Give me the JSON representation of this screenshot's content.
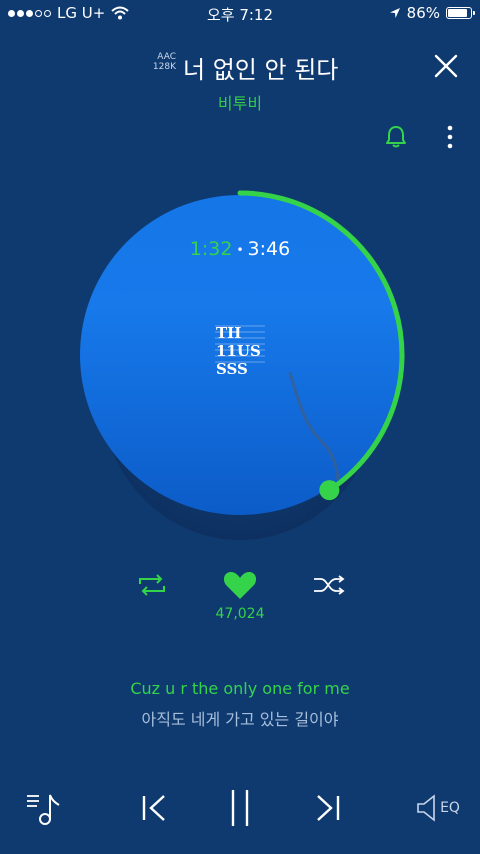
{
  "status_bar": {
    "carrier": "LG U+",
    "time": "오후 7:12",
    "battery": "86%",
    "battery_level": 0.86,
    "signal_bars": 3,
    "signal_total": 5
  },
  "header": {
    "quality_codec": "AAC",
    "quality_bitrate": "128K",
    "title": "너 없인 안 된다",
    "artist": "비투비"
  },
  "player": {
    "current_time": "1:32",
    "total_time": "3:46",
    "progress": 0.407,
    "album_art_text_top": "TH",
    "album_art_text_mid": "11US",
    "album_art_text_bottom": "SSS"
  },
  "actions": {
    "like_count": "47,024"
  },
  "lyrics": {
    "current": "Cuz u r the only one for me",
    "next": "아직도 네게 가고 있는 길이야"
  },
  "bottom": {
    "eq_label": "EQ"
  },
  "colors": {
    "background": "#0f3a70",
    "accent": "#34d34a",
    "disc": "#1576e8"
  },
  "icons": [
    "wifi-icon",
    "location-icon",
    "close-icon",
    "bell-icon",
    "more-icon",
    "repeat-icon",
    "heart-icon",
    "shuffle-icon",
    "playlist-icon",
    "prev-icon",
    "pause-icon",
    "next-icon",
    "eq-icon"
  ]
}
